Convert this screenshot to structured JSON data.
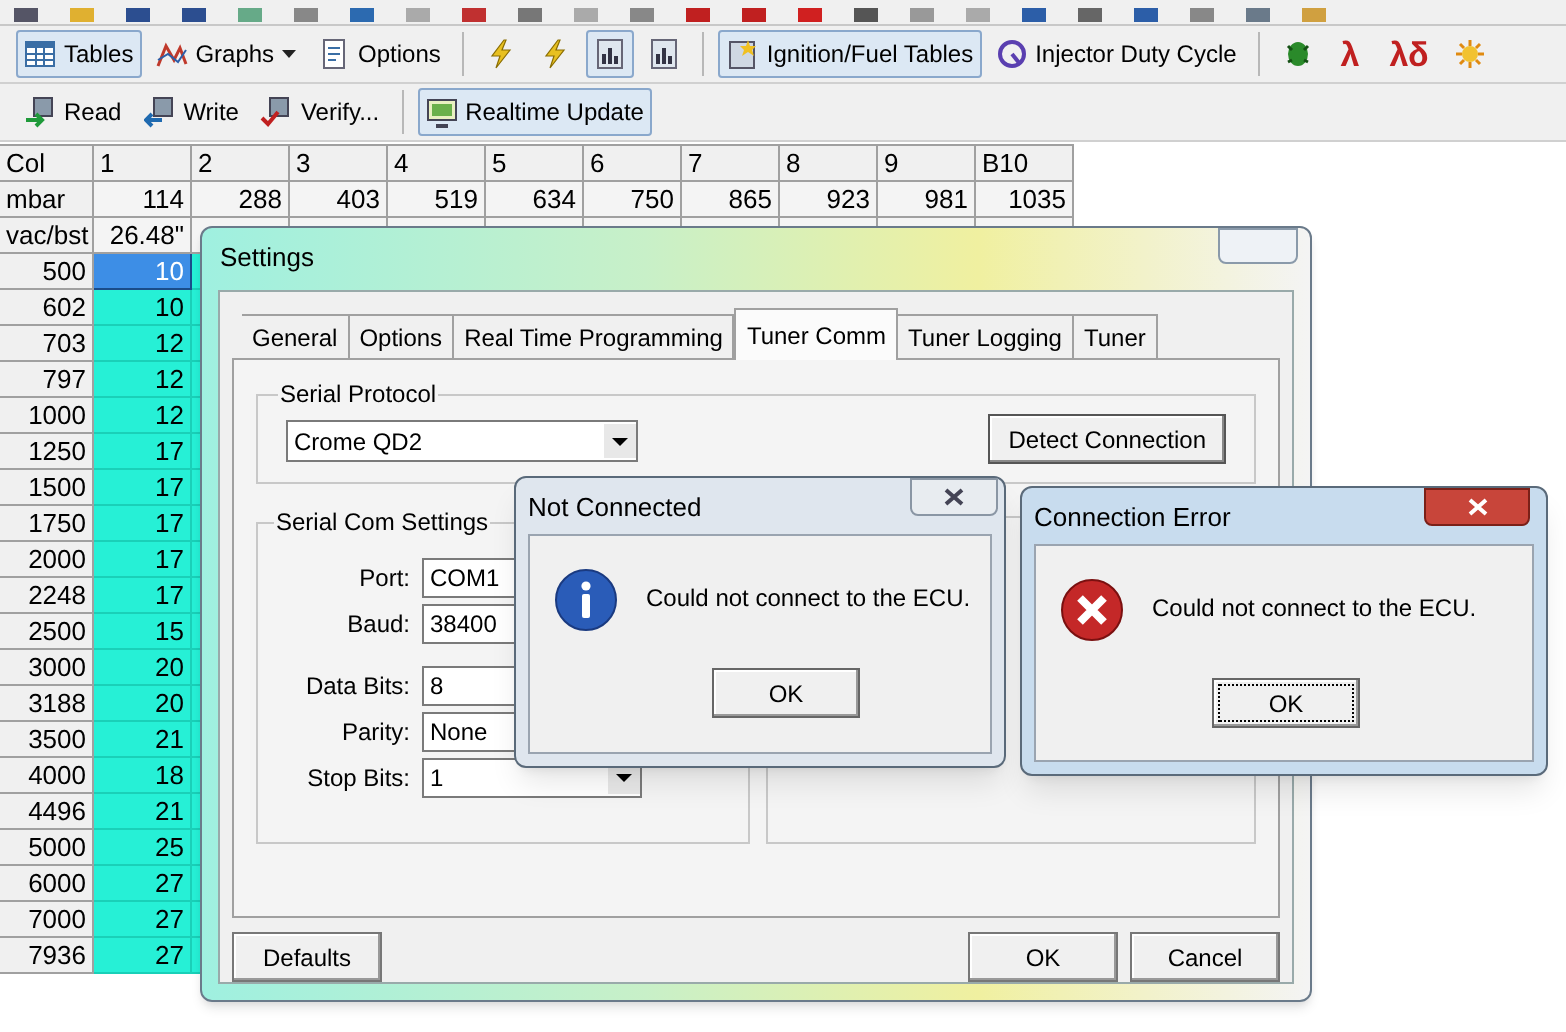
{
  "view_toolbar": [
    {
      "kind": "button",
      "label": "Tables",
      "pressed": true
    },
    {
      "kind": "menu_button",
      "label": "Graphs",
      "pressed": false
    },
    {
      "kind": "button",
      "label": "Options",
      "pressed": false
    },
    {
      "kind": "separator"
    },
    {
      "kind": "icon",
      "pressed": false
    },
    {
      "kind": "icon",
      "pressed": false
    },
    {
      "kind": "icon",
      "pressed": true
    },
    {
      "kind": "icon",
      "pressed": false
    },
    {
      "kind": "separator"
    },
    {
      "kind": "button",
      "label": "Ignition/Fuel Tables",
      "pressed": true
    },
    {
      "kind": "button",
      "label": "Injector Duty Cycle",
      "pressed": false
    },
    {
      "kind": "separator"
    },
    {
      "kind": "icon",
      "pressed": false
    },
    {
      "kind": "glyph",
      "label": "λ",
      "pressed": false
    },
    {
      "kind": "glyph",
      "label": "λδ",
      "pressed": false
    },
    {
      "kind": "icon",
      "pressed": false
    }
  ],
  "rw_toolbar": [
    {
      "kind": "button",
      "label": "Read",
      "pressed": false
    },
    {
      "kind": "button",
      "label": "Write",
      "pressed": false
    },
    {
      "kind": "button",
      "label": "Verify...",
      "pressed": false
    },
    {
      "kind": "separator"
    },
    {
      "kind": "button",
      "label": "Realtime Update",
      "pressed": true
    }
  ],
  "table": {
    "columns": [
      "Col",
      "1",
      "2",
      "3",
      "4",
      "5",
      "6",
      "7",
      "8",
      "9",
      "B10"
    ],
    "rows": [
      {
        "kind": "header",
        "selected": false,
        "cells": [
          "mbar",
          "114",
          "288",
          "403",
          "519",
          "634",
          "750",
          "865",
          "923",
          "981",
          "1035"
        ]
      },
      {
        "kind": "header",
        "selected": false,
        "cells": [
          "vac/bst",
          "26.48\""
        ]
      },
      {
        "kind": "data",
        "selected": true,
        "cells": [
          "500",
          "10"
        ]
      },
      {
        "kind": "data",
        "selected": false,
        "cells": [
          "602",
          "10"
        ]
      },
      {
        "kind": "data",
        "selected": false,
        "cells": [
          "703",
          "12"
        ]
      },
      {
        "kind": "data",
        "selected": false,
        "cells": [
          "797",
          "12"
        ]
      },
      {
        "kind": "data",
        "selected": false,
        "cells": [
          "1000",
          "12"
        ]
      },
      {
        "kind": "data",
        "selected": false,
        "cells": [
          "1250",
          "17"
        ]
      },
      {
        "kind": "data",
        "selected": false,
        "cells": [
          "1500",
          "17"
        ]
      },
      {
        "kind": "data",
        "selected": false,
        "cells": [
          "1750",
          "17"
        ]
      },
      {
        "kind": "data",
        "selected": false,
        "cells": [
          "2000",
          "17"
        ]
      },
      {
        "kind": "data",
        "selected": false,
        "cells": [
          "2248",
          "17"
        ]
      },
      {
        "kind": "data",
        "selected": false,
        "cells": [
          "2500",
          "15"
        ]
      },
      {
        "kind": "data",
        "selected": false,
        "cells": [
          "3000",
          "20"
        ]
      },
      {
        "kind": "data",
        "selected": false,
        "cells": [
          "3188",
          "20"
        ]
      },
      {
        "kind": "data",
        "selected": false,
        "cells": [
          "3500",
          "21"
        ]
      },
      {
        "kind": "data",
        "selected": false,
        "cells": [
          "4000",
          "18"
        ]
      },
      {
        "kind": "data",
        "selected": false,
        "cells": [
          "4496",
          "21"
        ]
      },
      {
        "kind": "data",
        "selected": false,
        "cells": [
          "5000",
          "25"
        ]
      },
      {
        "kind": "data",
        "selected": false,
        "cells": [
          "6000",
          "27"
        ]
      },
      {
        "kind": "data",
        "selected": false,
        "cells": [
          "7000",
          "27"
        ]
      },
      {
        "kind": "data",
        "selected": false,
        "cells": [
          "7936",
          "27"
        ]
      }
    ]
  },
  "settings": {
    "title": "Settings",
    "tabs": [
      {
        "label": "General",
        "selected": false
      },
      {
        "label": "Options",
        "selected": false
      },
      {
        "label": "Real Time Programming",
        "selected": false
      },
      {
        "label": "Tuner Comm",
        "selected": true
      },
      {
        "label": "Tuner Logging",
        "selected": false
      },
      {
        "label": "Tuner",
        "selected": false
      }
    ],
    "serial_protocol": {
      "label": "Serial Protocol",
      "value": "Crome QD2",
      "button": "Detect Connection"
    },
    "serial_com_settings": {
      "label": "Serial Com Settings",
      "fields": [
        {
          "label": "Port:",
          "value": "COM1",
          "kind": "text"
        },
        {
          "label": "Baud:",
          "value": "38400",
          "kind": "text"
        },
        {
          "label": "Data Bits:",
          "value": "8",
          "kind": "text"
        },
        {
          "label": "Parity:",
          "value": "None",
          "kind": "text"
        },
        {
          "label": "Stop Bits:",
          "value": "1",
          "kind": "dropdown"
        }
      ]
    },
    "buttons": [
      "Defaults",
      "OK",
      "Cancel"
    ]
  },
  "message_boxes": [
    {
      "title": "Not Connected",
      "message": "Could not connect to the ECU.",
      "kind": "info",
      "button": "OK",
      "active": false
    },
    {
      "title": "Connection Error",
      "message": "Could not connect to the ECU.",
      "kind": "error",
      "button": "OK",
      "active": true
    }
  ]
}
